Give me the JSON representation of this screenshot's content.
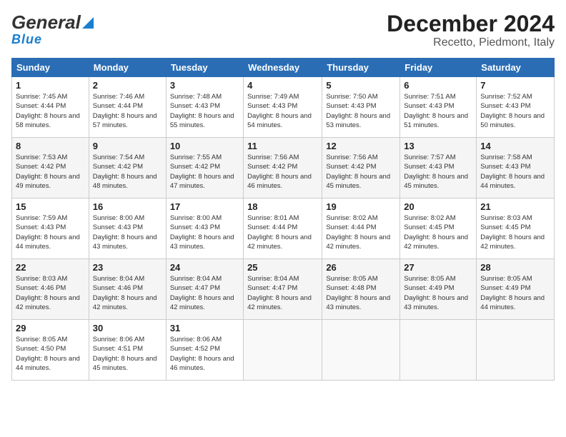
{
  "header": {
    "logo_general": "General",
    "logo_blue": "Blue",
    "title": "December 2024",
    "subtitle": "Recetto, Piedmont, Italy"
  },
  "calendar": {
    "days_of_week": [
      "Sunday",
      "Monday",
      "Tuesday",
      "Wednesday",
      "Thursday",
      "Friday",
      "Saturday"
    ],
    "weeks": [
      [
        {
          "day": "1",
          "sunrise": "7:45 AM",
          "sunset": "4:44 PM",
          "daylight": "8 hours and 58 minutes."
        },
        {
          "day": "2",
          "sunrise": "7:46 AM",
          "sunset": "4:44 PM",
          "daylight": "8 hours and 57 minutes."
        },
        {
          "day": "3",
          "sunrise": "7:48 AM",
          "sunset": "4:43 PM",
          "daylight": "8 hours and 55 minutes."
        },
        {
          "day": "4",
          "sunrise": "7:49 AM",
          "sunset": "4:43 PM",
          "daylight": "8 hours and 54 minutes."
        },
        {
          "day": "5",
          "sunrise": "7:50 AM",
          "sunset": "4:43 PM",
          "daylight": "8 hours and 53 minutes."
        },
        {
          "day": "6",
          "sunrise": "7:51 AM",
          "sunset": "4:43 PM",
          "daylight": "8 hours and 51 minutes."
        },
        {
          "day": "7",
          "sunrise": "7:52 AM",
          "sunset": "4:43 PM",
          "daylight": "8 hours and 50 minutes."
        }
      ],
      [
        {
          "day": "8",
          "sunrise": "7:53 AM",
          "sunset": "4:42 PM",
          "daylight": "8 hours and 49 minutes."
        },
        {
          "day": "9",
          "sunrise": "7:54 AM",
          "sunset": "4:42 PM",
          "daylight": "8 hours and 48 minutes."
        },
        {
          "day": "10",
          "sunrise": "7:55 AM",
          "sunset": "4:42 PM",
          "daylight": "8 hours and 47 minutes."
        },
        {
          "day": "11",
          "sunrise": "7:56 AM",
          "sunset": "4:42 PM",
          "daylight": "8 hours and 46 minutes."
        },
        {
          "day": "12",
          "sunrise": "7:56 AM",
          "sunset": "4:42 PM",
          "daylight": "8 hours and 45 minutes."
        },
        {
          "day": "13",
          "sunrise": "7:57 AM",
          "sunset": "4:43 PM",
          "daylight": "8 hours and 45 minutes."
        },
        {
          "day": "14",
          "sunrise": "7:58 AM",
          "sunset": "4:43 PM",
          "daylight": "8 hours and 44 minutes."
        }
      ],
      [
        {
          "day": "15",
          "sunrise": "7:59 AM",
          "sunset": "4:43 PM",
          "daylight": "8 hours and 44 minutes."
        },
        {
          "day": "16",
          "sunrise": "8:00 AM",
          "sunset": "4:43 PM",
          "daylight": "8 hours and 43 minutes."
        },
        {
          "day": "17",
          "sunrise": "8:00 AM",
          "sunset": "4:43 PM",
          "daylight": "8 hours and 43 minutes."
        },
        {
          "day": "18",
          "sunrise": "8:01 AM",
          "sunset": "4:44 PM",
          "daylight": "8 hours and 42 minutes."
        },
        {
          "day": "19",
          "sunrise": "8:02 AM",
          "sunset": "4:44 PM",
          "daylight": "8 hours and 42 minutes."
        },
        {
          "day": "20",
          "sunrise": "8:02 AM",
          "sunset": "4:45 PM",
          "daylight": "8 hours and 42 minutes."
        },
        {
          "day": "21",
          "sunrise": "8:03 AM",
          "sunset": "4:45 PM",
          "daylight": "8 hours and 42 minutes."
        }
      ],
      [
        {
          "day": "22",
          "sunrise": "8:03 AM",
          "sunset": "4:46 PM",
          "daylight": "8 hours and 42 minutes."
        },
        {
          "day": "23",
          "sunrise": "8:04 AM",
          "sunset": "4:46 PM",
          "daylight": "8 hours and 42 minutes."
        },
        {
          "day": "24",
          "sunrise": "8:04 AM",
          "sunset": "4:47 PM",
          "daylight": "8 hours and 42 minutes."
        },
        {
          "day": "25",
          "sunrise": "8:04 AM",
          "sunset": "4:47 PM",
          "daylight": "8 hours and 42 minutes."
        },
        {
          "day": "26",
          "sunrise": "8:05 AM",
          "sunset": "4:48 PM",
          "daylight": "8 hours and 43 minutes."
        },
        {
          "day": "27",
          "sunrise": "8:05 AM",
          "sunset": "4:49 PM",
          "daylight": "8 hours and 43 minutes."
        },
        {
          "day": "28",
          "sunrise": "8:05 AM",
          "sunset": "4:49 PM",
          "daylight": "8 hours and 44 minutes."
        }
      ],
      [
        {
          "day": "29",
          "sunrise": "8:05 AM",
          "sunset": "4:50 PM",
          "daylight": "8 hours and 44 minutes."
        },
        {
          "day": "30",
          "sunrise": "8:06 AM",
          "sunset": "4:51 PM",
          "daylight": "8 hours and 45 minutes."
        },
        {
          "day": "31",
          "sunrise": "8:06 AM",
          "sunset": "4:52 PM",
          "daylight": "8 hours and 46 minutes."
        },
        null,
        null,
        null,
        null
      ]
    ],
    "labels": {
      "sunrise": "Sunrise:",
      "sunset": "Sunset:",
      "daylight": "Daylight:"
    }
  }
}
